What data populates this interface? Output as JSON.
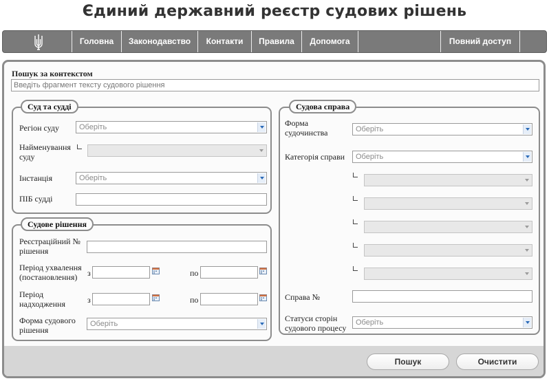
{
  "site": {
    "title": "Єдиний державний реєстр судових рішень"
  },
  "nav": {
    "items": [
      "Головна",
      "Законодавство",
      "Контакти",
      "Правила",
      "Допомога"
    ],
    "full_access": "Повний доступ"
  },
  "search": {
    "label": "Пошук за контекстом",
    "placeholder": "Введіть фрагмент тексту судового рішення"
  },
  "court_section": {
    "legend": "Суд та судді",
    "region_label": "Регіон суду",
    "region_value": "Оберіть",
    "name_label": "Найменування суду",
    "instance_label": "Інстанція",
    "instance_value": "Оберіть",
    "judge_label": "ПІБ судді"
  },
  "decision_section": {
    "legend": "Судове рішення",
    "reg_label": "Реєстраційний № рішення",
    "period_adopt_label": "Період ухвалення (постановлення)",
    "period_receive_label": "Період надходження",
    "from_label": "з",
    "to_label": "по",
    "form_label": "Форма судового рішення",
    "form_value": "Оберіть"
  },
  "case_section": {
    "legend": "Судова справа",
    "proc_form_label": "Форма судочинства",
    "proc_form_value": "Оберіть",
    "category_label": "Категорія справи",
    "category_value": "Оберіть",
    "case_no_label": "Справа №",
    "status_label": "Статуси сторін судового процесу",
    "status_value": "Оберіть"
  },
  "buttons": {
    "search": "Пошук",
    "clear": "Очистити"
  }
}
